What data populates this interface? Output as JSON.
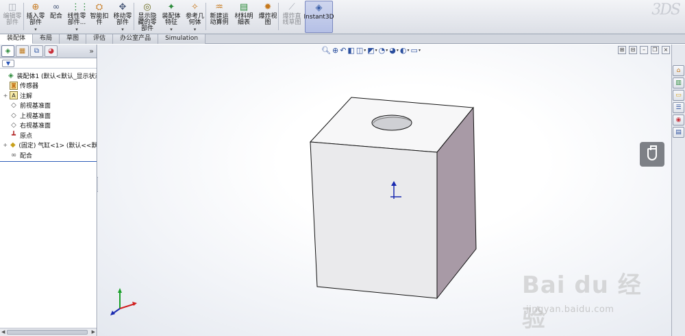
{
  "toolbar": {
    "buttons": [
      {
        "label": "编辑零\n部件",
        "icon": "edit-component-icon",
        "disabled": true,
        "dropdown": false
      },
      {
        "label": "插入零\n部件",
        "icon": "insert-component-icon",
        "disabled": false,
        "dropdown": true
      },
      {
        "label": "配合",
        "icon": "mate-icon",
        "disabled": false,
        "dropdown": false
      },
      {
        "label": "线性零\n部件...",
        "icon": "linear-pattern-icon",
        "disabled": false,
        "dropdown": true
      },
      {
        "label": "智能扣\n件",
        "icon": "smart-fastener-icon",
        "disabled": false,
        "dropdown": false
      },
      {
        "label": "移动零\n部件",
        "icon": "move-component-icon",
        "disabled": false,
        "dropdown": true
      },
      {
        "label": "显示隐\n藏的零\n部件",
        "icon": "show-hidden-icon",
        "disabled": false,
        "dropdown": false
      },
      {
        "label": "装配体\n特征",
        "icon": "assembly-feature-icon",
        "disabled": false,
        "dropdown": true
      },
      {
        "label": "参考几\n何体",
        "icon": "reference-geometry-icon",
        "disabled": false,
        "dropdown": true
      },
      {
        "label": "新建运\n动算例",
        "icon": "motion-study-icon",
        "disabled": false,
        "dropdown": false
      },
      {
        "label": "材料明\n细表",
        "icon": "bom-icon",
        "disabled": false,
        "dropdown": false
      },
      {
        "label": "爆炸视\n图",
        "icon": "exploded-view-icon",
        "disabled": false,
        "dropdown": false
      },
      {
        "label": "爆炸直\n线草图",
        "icon": "explode-line-sketch-icon",
        "disabled": true,
        "dropdown": false
      },
      {
        "label": "Instant3D",
        "icon": "instant3d-icon",
        "disabled": false,
        "dropdown": false,
        "active": true
      }
    ],
    "logo": "3DS"
  },
  "tabs": [
    "装配体",
    "布局",
    "草图",
    "评估",
    "办公室产品",
    "Simulation"
  ],
  "active_tab": "装配体",
  "feature_tree": {
    "filter_icon": "filter-icon",
    "items": [
      {
        "label": "装配体1  (默认<默认_显示状态-",
        "icon": "assembly-icon",
        "expand": "",
        "indent": 0
      },
      {
        "label": "传感器",
        "icon": "sensor-icon",
        "expand": "",
        "indent": 1
      },
      {
        "label": "注解",
        "icon": "annotation-icon",
        "expand": "+",
        "indent": 1
      },
      {
        "label": "前视基准面",
        "icon": "plane-icon",
        "expand": "",
        "indent": 1
      },
      {
        "label": "上视基准面",
        "icon": "plane-icon",
        "expand": "",
        "indent": 1
      },
      {
        "label": "右视基准面",
        "icon": "plane-icon",
        "expand": "",
        "indent": 1
      },
      {
        "label": "原点",
        "icon": "origin-icon",
        "expand": "",
        "indent": 1
      },
      {
        "label": "(固定) 气缸<1> (默认<<默认",
        "icon": "part-icon",
        "expand": "+",
        "indent": 1
      },
      {
        "label": "配合",
        "icon": "mates-folder-icon",
        "expand": "",
        "indent": 1
      }
    ]
  },
  "hud_icons": [
    "zoom-to-fit-icon",
    "zoom-area-icon",
    "previous-view-icon",
    "section-view-icon",
    "view-orientation-icon",
    "display-style-icon",
    "hide-show-icon",
    "edit-appearance-icon",
    "apply-scene-icon",
    "view-settings-icon"
  ],
  "watermark": {
    "main": "Bai du 经验",
    "sub": "jingyan.baidu.com"
  },
  "colors": {
    "accent": "#2f5fb8",
    "part_face_front": "#eaeaec",
    "part_face_side": "#a89aa6",
    "part_face_top": "#f7f7f8"
  }
}
